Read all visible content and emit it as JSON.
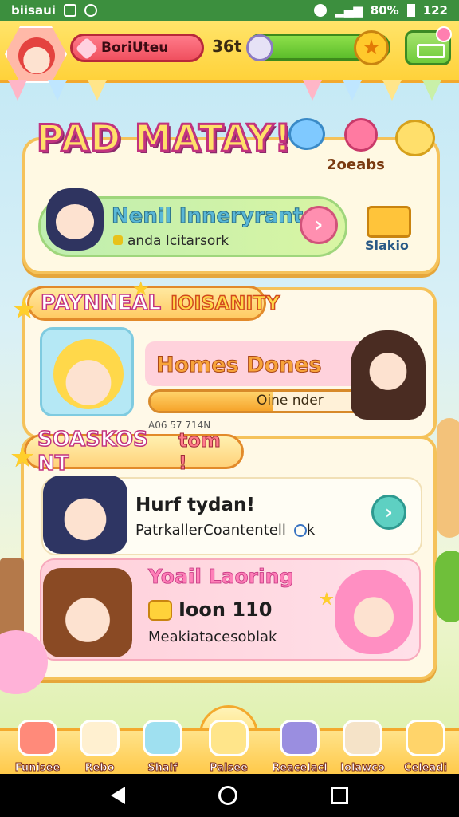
{
  "status_bar": {
    "carrier": "biisaui",
    "battery": "80%",
    "time": "122"
  },
  "header": {
    "player_name": "BoriUteu",
    "level_label": "36t"
  },
  "hero": {
    "title": "PAD MATAY!",
    "badge": "2oeabs",
    "quest_title": "Nenil Inneryrant",
    "quest_sub": "anda Icitarsork",
    "shop_label": "Slakio"
  },
  "section2": {
    "ribbon_left": "PAYNNEAL",
    "ribbon_right": "IOISANITY",
    "dream_title": "Homes Dones",
    "progress_label": "Oine nder",
    "progress_value": 0.52,
    "note": "A06 57 714N"
  },
  "section3": {
    "ribbon_left": "SOASKOS NT",
    "ribbon_right": "tom !",
    "row1_title": "Hurf tydan!",
    "row1_sub": "PatrkallerCoantentell",
    "row1_clock": "k",
    "row2_title": "Yoail Laoring",
    "row2_value": "Ioon 110",
    "row2_sub": "Meakiatacesoblak"
  },
  "bottom_nav": [
    {
      "label": "Funisee",
      "color": "#ff8a7a"
    },
    {
      "label": "Rebo",
      "color": "#fff0d0"
    },
    {
      "label": "Shalf",
      "color": "#9fe0f0"
    },
    {
      "label": "Palsee",
      "color": "#ffe58a"
    },
    {
      "label": "Reacelacl",
      "color": "#9a8ee0"
    },
    {
      "label": "Iolawco",
      "color": "#f5e3c8"
    },
    {
      "label": "Celeadi",
      "color": "#ffd46a"
    }
  ]
}
